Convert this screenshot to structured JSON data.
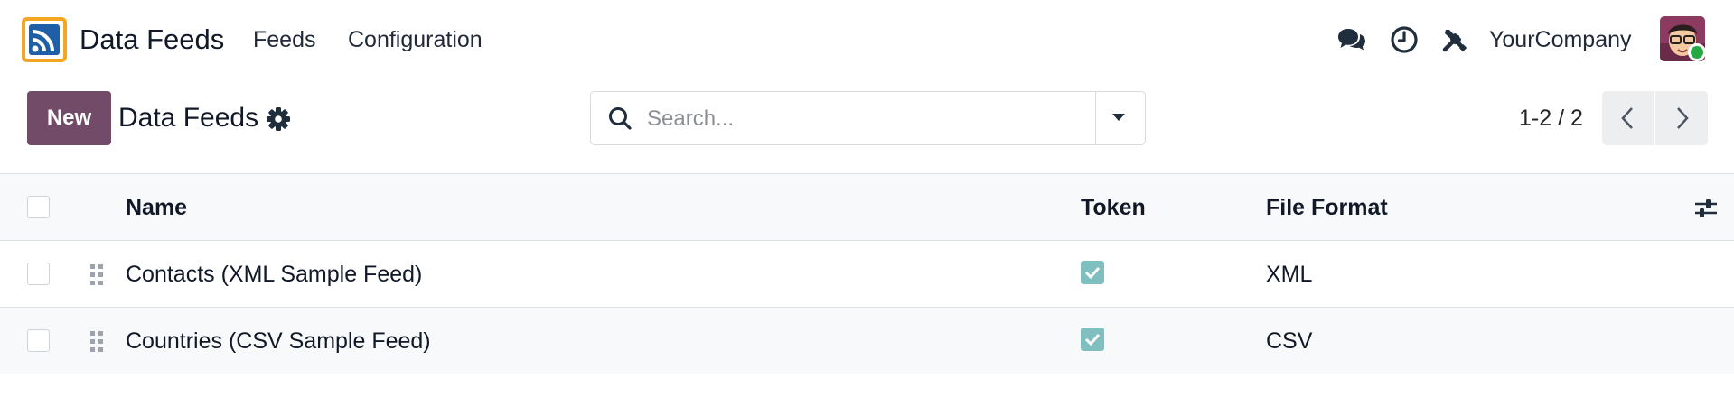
{
  "app": {
    "title": "Data Feeds",
    "logo_icon": "rss-feed-icon",
    "accent_color": "#f5a623"
  },
  "menu": {
    "items": [
      {
        "label": "Feeds"
      },
      {
        "label": "Configuration"
      }
    ]
  },
  "systray": {
    "icons": [
      "chat-icon",
      "clock-icon",
      "tools-icon"
    ],
    "company": "YourCompany",
    "presence_color": "#28a745"
  },
  "control_panel": {
    "new_button": "New",
    "breadcrumb": "Data Feeds",
    "search_placeholder": "Search...",
    "pager": "1-2 / 2",
    "primary_color": "#714b67"
  },
  "list": {
    "columns": [
      {
        "label": "Name"
      },
      {
        "label": "Token"
      },
      {
        "label": "File Format"
      }
    ],
    "rows": [
      {
        "name": "Contacts (XML Sample Feed)",
        "token": true,
        "file_format": "XML"
      },
      {
        "name": "Countries (CSV Sample Feed)",
        "token": true,
        "file_format": "CSV"
      }
    ],
    "checked_color": "#7fbfbf"
  }
}
